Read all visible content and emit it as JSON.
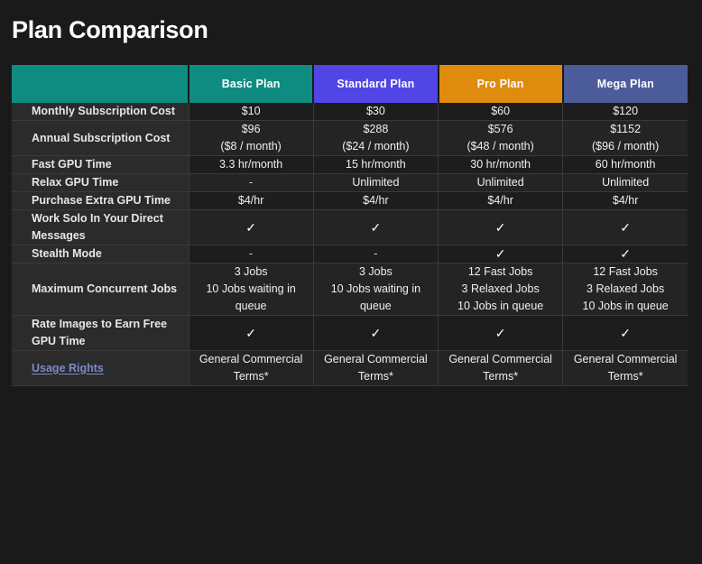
{
  "page": {
    "title": "Plan Comparison",
    "background": "#1a1a1a"
  },
  "colors": {
    "basic": "#0f8c82",
    "standard": "#5145e5",
    "pro": "#df8b0d",
    "mega": "#4c5c9b",
    "link": "#7e8ac9",
    "label_bg": "#2b2b2b",
    "cell_bg_dark": "#1d1d1d",
    "cell_bg_light": "#242424",
    "grid": "#3a3a3a"
  },
  "table": {
    "corner_label": "",
    "columns": [
      {
        "label": "Basic Plan",
        "key": "basic"
      },
      {
        "label": "Standard Plan",
        "key": "standard"
      },
      {
        "label": "Pro Plan",
        "key": "pro"
      },
      {
        "label": "Mega Plan",
        "key": "mega"
      }
    ],
    "rows": [
      {
        "label": "Monthly Subscription Cost",
        "is_link": false,
        "values": [
          {
            "lines": [
              "$10"
            ]
          },
          {
            "lines": [
              "$30"
            ]
          },
          {
            "lines": [
              "$60"
            ]
          },
          {
            "lines": [
              "$120"
            ]
          }
        ]
      },
      {
        "label": "Annual Subscription Cost",
        "is_link": false,
        "values": [
          {
            "lines": [
              "$96",
              "($8 / month)"
            ]
          },
          {
            "lines": [
              "$288",
              "($24 / month)"
            ]
          },
          {
            "lines": [
              "$576",
              "($48 / month)"
            ]
          },
          {
            "lines": [
              "$1152",
              "($96 / month)"
            ]
          }
        ]
      },
      {
        "label": "Fast GPU Time",
        "is_link": false,
        "values": [
          {
            "lines": [
              "3.3 hr/month"
            ]
          },
          {
            "lines": [
              "15 hr/month"
            ]
          },
          {
            "lines": [
              "30 hr/month"
            ]
          },
          {
            "lines": [
              "60 hr/month"
            ]
          }
        ]
      },
      {
        "label": "Relax GPU Time",
        "is_link": false,
        "values": [
          {
            "lines": [
              "-"
            ]
          },
          {
            "lines": [
              "Unlimited"
            ]
          },
          {
            "lines": [
              "Unlimited"
            ]
          },
          {
            "lines": [
              "Unlimited"
            ]
          }
        ]
      },
      {
        "label": "Purchase Extra GPU Time",
        "is_link": false,
        "values": [
          {
            "lines": [
              "$4/hr"
            ]
          },
          {
            "lines": [
              "$4/hr"
            ]
          },
          {
            "lines": [
              "$4/hr"
            ]
          },
          {
            "lines": [
              "$4/hr"
            ]
          }
        ]
      },
      {
        "label": "Work Solo In Your Direct Messages",
        "is_link": false,
        "values": [
          {
            "lines": [
              "✓"
            ]
          },
          {
            "lines": [
              "✓"
            ]
          },
          {
            "lines": [
              "✓"
            ]
          },
          {
            "lines": [
              "✓"
            ]
          }
        ]
      },
      {
        "label": "Stealth Mode",
        "is_link": false,
        "values": [
          {
            "lines": [
              "-"
            ]
          },
          {
            "lines": [
              "-"
            ]
          },
          {
            "lines": [
              "✓"
            ]
          },
          {
            "lines": [
              "✓"
            ]
          }
        ]
      },
      {
        "label": "Maximum Concurrent Jobs",
        "is_link": false,
        "values": [
          {
            "lines": [
              "3 Jobs",
              "10 Jobs waiting in queue"
            ]
          },
          {
            "lines": [
              "3 Jobs",
              "10 Jobs waiting in queue"
            ]
          },
          {
            "lines": [
              "12 Fast Jobs",
              "3 Relaxed Jobs",
              "10 Jobs in queue"
            ]
          },
          {
            "lines": [
              "12 Fast Jobs",
              "3 Relaxed Jobs",
              "10 Jobs in queue"
            ]
          }
        ]
      },
      {
        "label": "Rate Images to Earn Free GPU Time",
        "is_link": false,
        "values": [
          {
            "lines": [
              "✓"
            ]
          },
          {
            "lines": [
              "✓"
            ]
          },
          {
            "lines": [
              "✓"
            ]
          },
          {
            "lines": [
              "✓"
            ]
          }
        ]
      },
      {
        "label": "Usage Rights",
        "is_link": true,
        "values": [
          {
            "lines": [
              "General Commercial Terms*"
            ]
          },
          {
            "lines": [
              "General Commercial Terms*"
            ]
          },
          {
            "lines": [
              "General Commercial Terms*"
            ]
          },
          {
            "lines": [
              "General Commercial Terms*"
            ]
          }
        ]
      }
    ]
  }
}
